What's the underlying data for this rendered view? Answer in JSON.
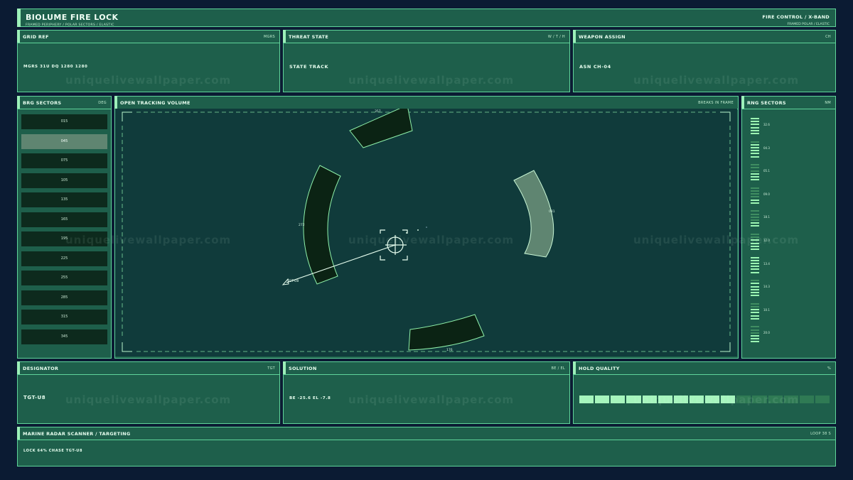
{
  "header": {
    "title": "BIOLUME FIRE LOCK",
    "subtitle": "FRAMED PERIPHERY / POLAR SECTORS / ELASTIC",
    "right_title": "FIRE CONTROL / X-BAND",
    "right_subtitle": "FRAMED POLAR / ELASTIC"
  },
  "top_panels": [
    {
      "title": "GRID REF",
      "tag": "MGRS",
      "value": "MGRS 31U DQ 1280 1280"
    },
    {
      "title": "THREAT STATE",
      "tag": "W / T / H",
      "value": "STATE TRACK"
    },
    {
      "title": "WEAPON ASSIGN",
      "tag": "CH",
      "value": "ASN CH-04"
    }
  ],
  "brg_sectors": {
    "title": "BRG SECTORS",
    "tag": "DEG",
    "items": [
      "015",
      "045",
      "075",
      "105",
      "135",
      "165",
      "195",
      "225",
      "255",
      "285",
      "315",
      "345"
    ],
    "active_index": 1
  },
  "tracking": {
    "title": "OPEN TRACKING VOLUME",
    "tag": "BREAKS IN FRAME",
    "labels": {
      "top": "357",
      "right": "081",
      "left": "272",
      "bottom": "176"
    },
    "target_label": "TGT-U8"
  },
  "rng_sectors": {
    "title": "RNG SECTORS",
    "tag": "NM",
    "items": [
      {
        "label": "32.6",
        "level": 5
      },
      {
        "label": "04.3",
        "level": 4
      },
      {
        "label": "05.1",
        "level": 2
      },
      {
        "label": "09.0",
        "level": 1
      },
      {
        "label": "18.1",
        "level": 1
      },
      {
        "label": "12.0",
        "level": 3
      },
      {
        "label": "13.4",
        "level": 5
      },
      {
        "label": "14.3",
        "level": 4
      },
      {
        "label": "10.1",
        "level": 3
      },
      {
        "label": "20.0",
        "level": 2
      }
    ]
  },
  "bottom_panels": [
    {
      "title": "DESIGNATOR",
      "tag": "TGT",
      "value": "TGT-U8"
    },
    {
      "title": "SOLUTION",
      "tag": "BE / EL",
      "value": "BE -25.6  EL -7.8"
    },
    {
      "title": "HOLD QUALITY",
      "tag": "%",
      "segments_total": 16,
      "segments_lit": 10,
      "quality_fraction": 0.64
    }
  ],
  "footer": {
    "title": "MARINE RADAR SCANNER / TARGETING",
    "tag": "LOOP 38 S",
    "status": "LOCK 64%  CHASE TGT-U8"
  },
  "watermark": "uniquelivewallpaper.com",
  "colors": {
    "accent": "#5fd49a",
    "bright": "#9cf0b9",
    "panel": "#1e5f4b",
    "radar_bg": "#103b3b",
    "arc_fill": "#0b2314"
  }
}
